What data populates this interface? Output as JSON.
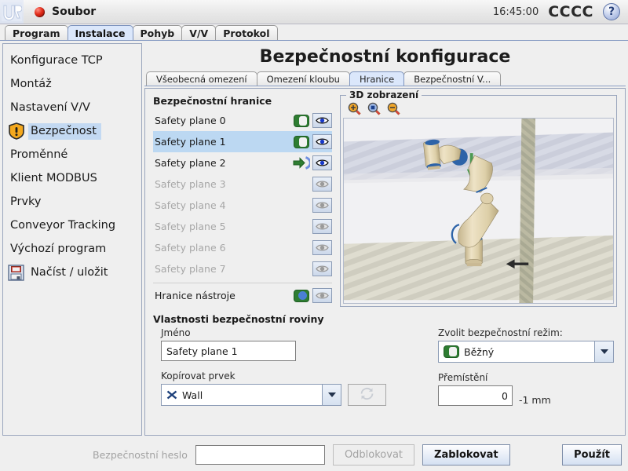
{
  "titlebar": {
    "logo": "ur-logo",
    "menu_label": "Soubor",
    "clock": "16:45:00",
    "robot_name": "CCCC",
    "help_label": "?"
  },
  "main_tabs": [
    {
      "label": "Program",
      "active": false
    },
    {
      "label": "Instalace",
      "active": true
    },
    {
      "label": "Pohyb",
      "active": false
    },
    {
      "label": "V/V",
      "active": false
    },
    {
      "label": "Protokol",
      "active": false
    }
  ],
  "sidebar": {
    "items": [
      {
        "label": "Konfigurace TCP",
        "icon": "",
        "selected": false
      },
      {
        "label": "Montáž",
        "icon": "",
        "selected": false
      },
      {
        "label": "Nastavení V/V",
        "icon": "",
        "selected": false
      },
      {
        "label": "Bezpečnost",
        "icon": "warning-shield-icon",
        "selected": true
      },
      {
        "label": "Proměnné",
        "icon": "",
        "selected": false
      },
      {
        "label": "Klient MODBUS",
        "icon": "",
        "selected": false
      },
      {
        "label": "Prvky",
        "icon": "",
        "selected": false
      },
      {
        "label": "Conveyor Tracking",
        "icon": "",
        "selected": false
      },
      {
        "label": "Výchozí program",
        "icon": "",
        "selected": false
      },
      {
        "label": "Načíst / uložit",
        "icon": "save-floppy-icon",
        "selected": false
      }
    ]
  },
  "page": {
    "title": "Bezpečnostní konfigurace",
    "sub_tabs": [
      {
        "label": "Všeobecná omezení",
        "active": false
      },
      {
        "label": "Omezení kloubu",
        "active": false
      },
      {
        "label": "Hranice",
        "active": true
      },
      {
        "label": "Bezpečnostní V...",
        "active": false
      }
    ]
  },
  "boundaries": {
    "section_title": "Bezpečnostní hranice",
    "planes": [
      {
        "name": "Safety plane 0",
        "enabled": true,
        "selected": false,
        "mode_icon": "toggle-green-icon",
        "eye": "eye-active-icon"
      },
      {
        "name": "Safety plane 1",
        "enabled": true,
        "selected": true,
        "mode_icon": "toggle-green-icon",
        "eye": "eye-active-icon"
      },
      {
        "name": "Safety plane 2",
        "enabled": true,
        "selected": false,
        "mode_icon": "arrow-into-bracket-icon",
        "eye": "eye-active-icon"
      },
      {
        "name": "Safety plane 3",
        "enabled": false,
        "selected": false,
        "mode_icon": "",
        "eye": "eye-inactive-icon"
      },
      {
        "name": "Safety plane 4",
        "enabled": false,
        "selected": false,
        "mode_icon": "",
        "eye": "eye-inactive-icon"
      },
      {
        "name": "Safety plane 5",
        "enabled": false,
        "selected": false,
        "mode_icon": "",
        "eye": "eye-inactive-icon"
      },
      {
        "name": "Safety plane 6",
        "enabled": false,
        "selected": false,
        "mode_icon": "",
        "eye": "eye-inactive-icon"
      },
      {
        "name": "Safety plane 7",
        "enabled": false,
        "selected": false,
        "mode_icon": "",
        "eye": "eye-inactive-icon"
      }
    ],
    "tool_boundary": {
      "name": "Hranice nástroje",
      "mode_icon": "toggle-green-blue-icon",
      "eye": "eye-inactive-icon"
    }
  },
  "view3d": {
    "legend": "3D zobrazení",
    "zoom_in_icon": "zoom-in-icon",
    "zoom_fit_icon": "zoom-fit-icon",
    "zoom_out_icon": "zoom-out-icon"
  },
  "properties": {
    "title": "Vlastnosti bezpečnostní roviny",
    "name_label": "Jméno",
    "name_value": "Safety plane 1",
    "copy_feature_label": "Kopírovat prvek",
    "copy_feature_value": "Wall",
    "copy_feature_icon": "plane-feature-icon",
    "refresh_icon": "refresh-icon",
    "mode_label": "Zvolit bezpečnostní režim:",
    "mode_value": "Běžný",
    "mode_icon": "toggle-green-icon",
    "displacement_label": "Přemístění",
    "displacement_value": "0",
    "displacement_unit": "-1 mm"
  },
  "footer": {
    "password_label": "Bezpečnostní heslo",
    "password_value": "",
    "unlock_label": "Odblokovat",
    "lock_label": "Zablokovat",
    "apply_label": "Použít"
  },
  "colors": {
    "accent_blue": "#bcd8f2",
    "tab_active": "#dbe7fb",
    "toggle_green": "#2e7d32",
    "warning_orange": "#f0a818",
    "eye_pupil": "#1638c8",
    "robot_beige": "#ded0ac",
    "joint_blue": "#2d63a8"
  }
}
